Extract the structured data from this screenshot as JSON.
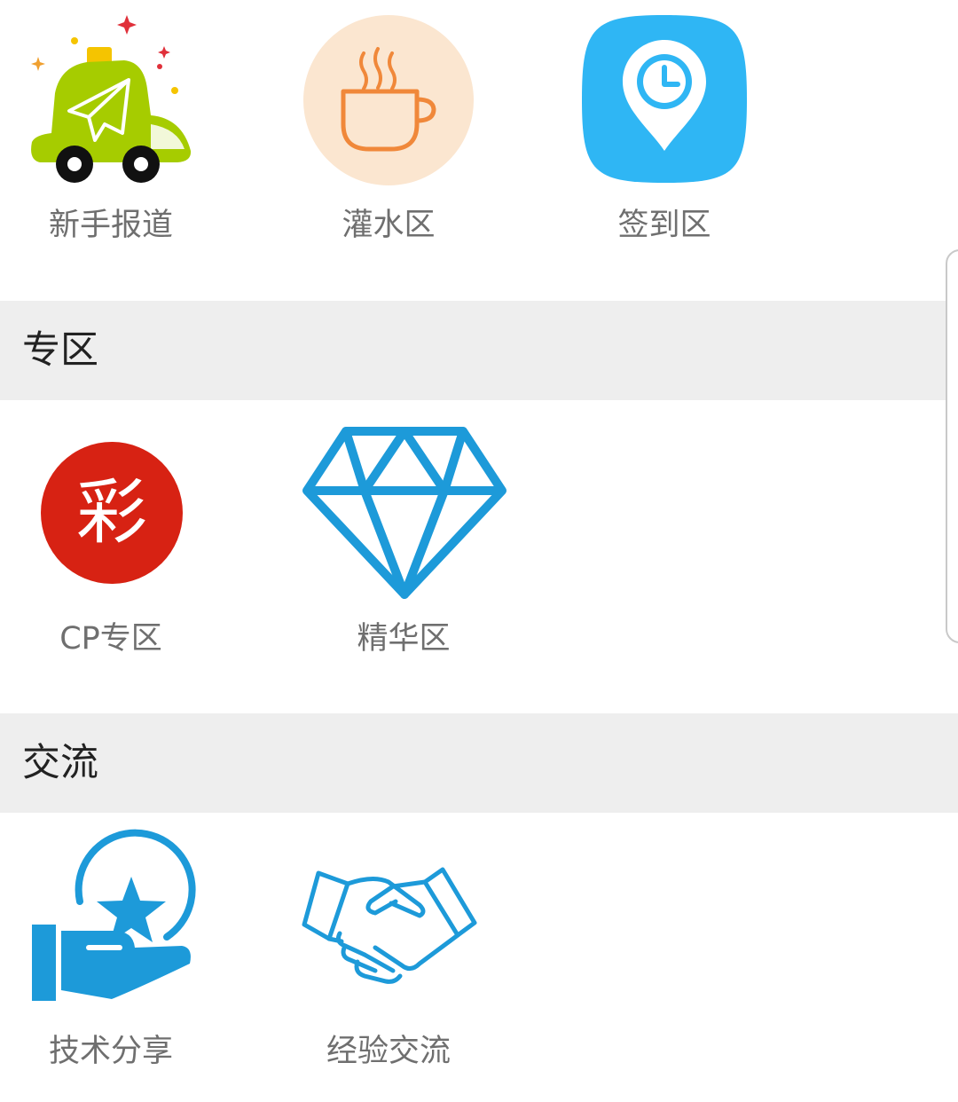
{
  "sections": [
    {
      "header": null,
      "items": [
        {
          "label": "新手报道",
          "icon": "green-car-paper-plane-icon"
        },
        {
          "label": "灌水区",
          "icon": "coffee-cup-icon"
        },
        {
          "label": "签到区",
          "icon": "clock-location-pin-icon"
        }
      ]
    },
    {
      "header": "专区",
      "items": [
        {
          "label": "CP专区",
          "icon": "red-cai-badge-icon",
          "icon_text": "彩"
        },
        {
          "label": "精华区",
          "icon": "diamond-icon"
        }
      ]
    },
    {
      "header": "交流",
      "items": [
        {
          "label": "技术分享",
          "icon": "hand-star-coin-icon"
        },
        {
          "label": "经验交流",
          "icon": "handshake-icon"
        }
      ]
    }
  ],
  "colors": {
    "section_header_bg": "#eeeeee",
    "label_text": "#6f6f6f",
    "header_text": "#222222",
    "icon_blue": "#1d9ad9",
    "pin_blue": "#2fb6f4",
    "badge_red": "#d72213",
    "car_green": "#a6cc00",
    "cup_orange": "#f0883a",
    "cup_bg": "#fbe6d0"
  }
}
